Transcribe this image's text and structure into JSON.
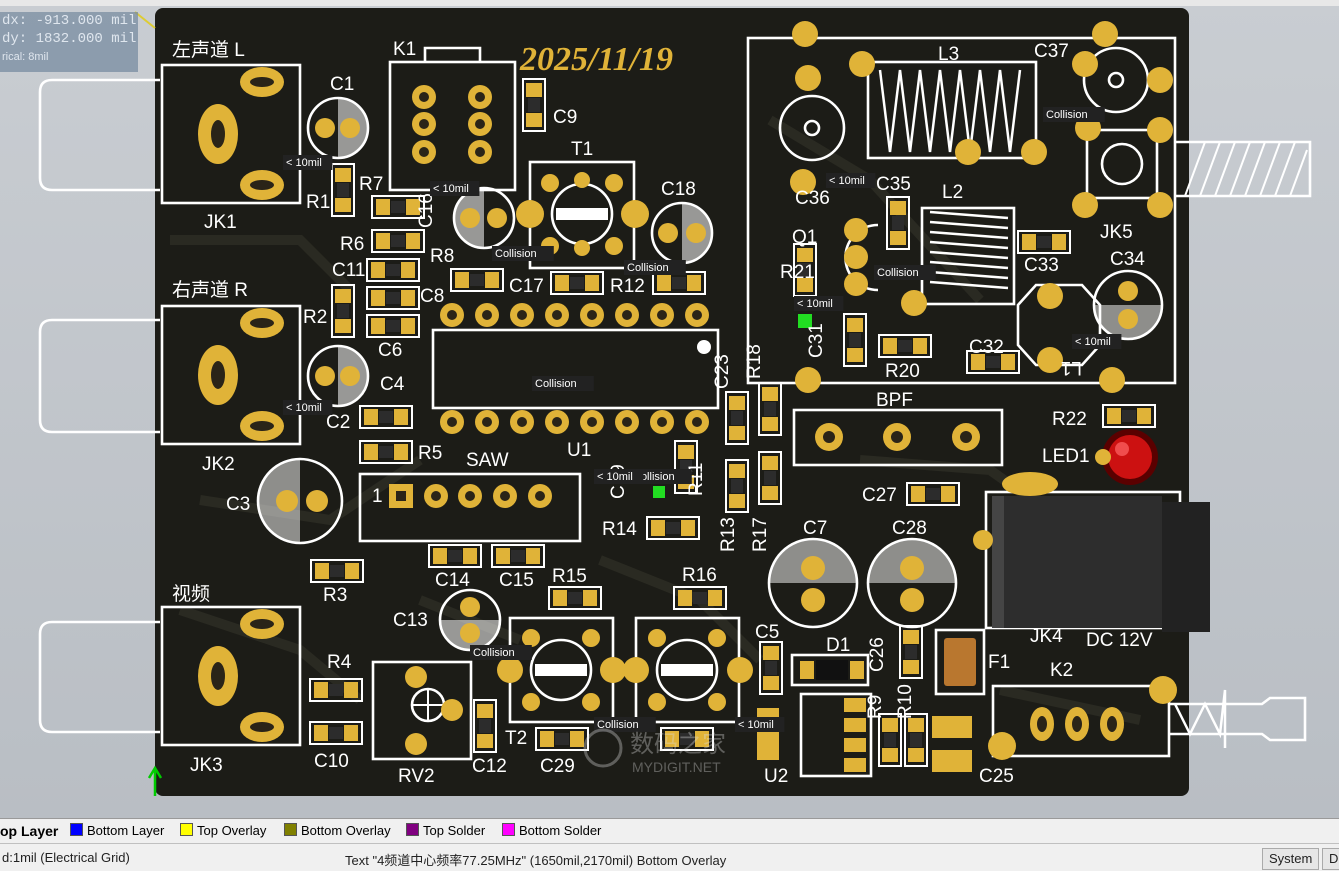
{
  "hud": {
    "dx": "dx: -913.000 mil",
    "dy": "dy: 1832.000 mil",
    "snap": "rical: 8mil"
  },
  "board": {
    "date": "2025/11/19",
    "labels": {
      "left_channel": "左声道 L",
      "right_channel": "右声道 R",
      "video": "视频",
      "dc": "DC 12V",
      "one": "1",
      "bpf": "BPF",
      "saw": "SAW"
    },
    "refdes": [
      "JK1",
      "JK2",
      "JK3",
      "C1",
      "R1",
      "R7",
      "C16",
      "R6",
      "R8",
      "C11",
      "C8",
      "R2",
      "C6",
      "C4",
      "C2",
      "C3",
      "R5",
      "K1",
      "C9",
      "T1",
      "C18",
      "C17",
      "R12",
      "U1",
      "C23",
      "R18",
      "C14",
      "C15",
      "R3",
      "C13",
      "R4",
      "C10",
      "RV2",
      "C12",
      "R15",
      "R16",
      "R14",
      "C29",
      "T2",
      "C5",
      "D1",
      "U2",
      "R11",
      "R13",
      "R17",
      "C7",
      "C28",
      "C27",
      "C26",
      "F1",
      "R9",
      "R10",
      "K2",
      "C25",
      "JK4",
      "L3",
      "C37",
      "C36",
      "C35",
      "L2",
      "Q1",
      "R21",
      "C31",
      "R20",
      "C32",
      "C33",
      "C34",
      "L1",
      "JK5",
      "R22",
      "LED1",
      "C19"
    ],
    "violations": {
      "collision": "Collision",
      "clearance": "< 10mil"
    },
    "watermark": {
      "cn": "数码之家",
      "url": "MYDIGIT.NET"
    }
  },
  "tabs": [
    {
      "label": "op Layer",
      "color": "#ff0000",
      "active": true
    },
    {
      "label": "Bottom Layer",
      "color": "#0000ff",
      "active": false
    },
    {
      "label": "Top Overlay",
      "color": "#ffff00",
      "active": false
    },
    {
      "label": "Bottom Overlay",
      "color": "#808000",
      "active": false
    },
    {
      "label": "Top Solder",
      "color": "#800080",
      "active": false
    },
    {
      "label": "Bottom Solder",
      "color": "#ff00ff",
      "active": false
    }
  ],
  "status": {
    "grid": "d:1mil   (Electrical Grid)",
    "selection": "Text \"4频道中心频率77.25MHz\" (1650mil,2170mil)  Bottom Overlay",
    "system_button": "System",
    "d_button": "D"
  }
}
